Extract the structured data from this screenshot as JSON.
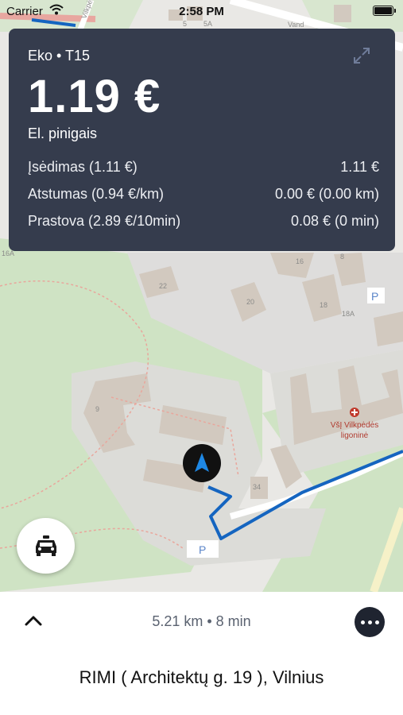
{
  "status_bar": {
    "carrier": "Carrier",
    "time": "2:58 PM"
  },
  "fare": {
    "service": "Eko • T15",
    "price": "1.19 €",
    "payment": "El. pinigais",
    "rows": [
      {
        "label": "Įsėdimas (1.11 €)",
        "value": "1.11 €"
      },
      {
        "label": "Atstumas (0.94 €/km)",
        "value": "0.00 € (0.00 km)"
      },
      {
        "label": "Prastova (2.89 €/10min)",
        "value": "0.08 € (0 min)"
      }
    ]
  },
  "map": {
    "house_numbers": [
      "5",
      "5A",
      "22",
      "20",
      "16",
      "18",
      "18A",
      "8",
      "9",
      "34",
      "16A",
      "19"
    ],
    "poi_name_line1": "VšĮ Vilkpėdės",
    "poi_name_line2": "ligoninė",
    "street_label": "Vand",
    "street_label_2": "Vilkpėdes",
    "parking_label": "P",
    "route_color": "#1565c0",
    "marker_icon": "navigation-arrow-icon"
  },
  "trip": {
    "summary": "5.21 km • 8 min",
    "destination": "RIMI ( Architektų g. 19 ), Vilnius"
  },
  "colors": {
    "card_bg": "#353c4d",
    "accent_blue": "#1e88e5"
  }
}
